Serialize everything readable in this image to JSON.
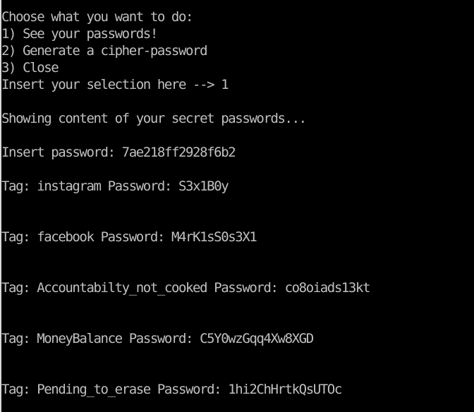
{
  "menu": {
    "prompt": "Choose what you want to do:",
    "options": [
      "1) See your passwords!",
      "2) Generate a cipher-password",
      "3) Close"
    ],
    "selection_prompt": "Insert your selection here --> ",
    "selection_value": "1"
  },
  "output": {
    "showing_message": "Showing content of your secret passwords...",
    "insert_password_label": "Insert password: ",
    "insert_password_value": "7ae218ff2928f6b2",
    "tag_label": "Tag: ",
    "password_label": "Password: ",
    "entries": [
      {
        "tag": "instagram",
        "password": "S3x1B0y"
      },
      {
        "tag": "facebook",
        "password": "M4rK1sS0s3X1"
      },
      {
        "tag": "Accountabilty_not_cooked",
        "password": "co8oiads13kt"
      },
      {
        "tag": "MoneyBalance",
        "password": "C5Y0wzGqq4Xw8XGD"
      },
      {
        "tag": "Pending_to_erase",
        "password": "1hi2ChHrtkQsUTOc"
      }
    ]
  },
  "colors": {
    "background": "#000000",
    "text": "#c0c0c0"
  }
}
